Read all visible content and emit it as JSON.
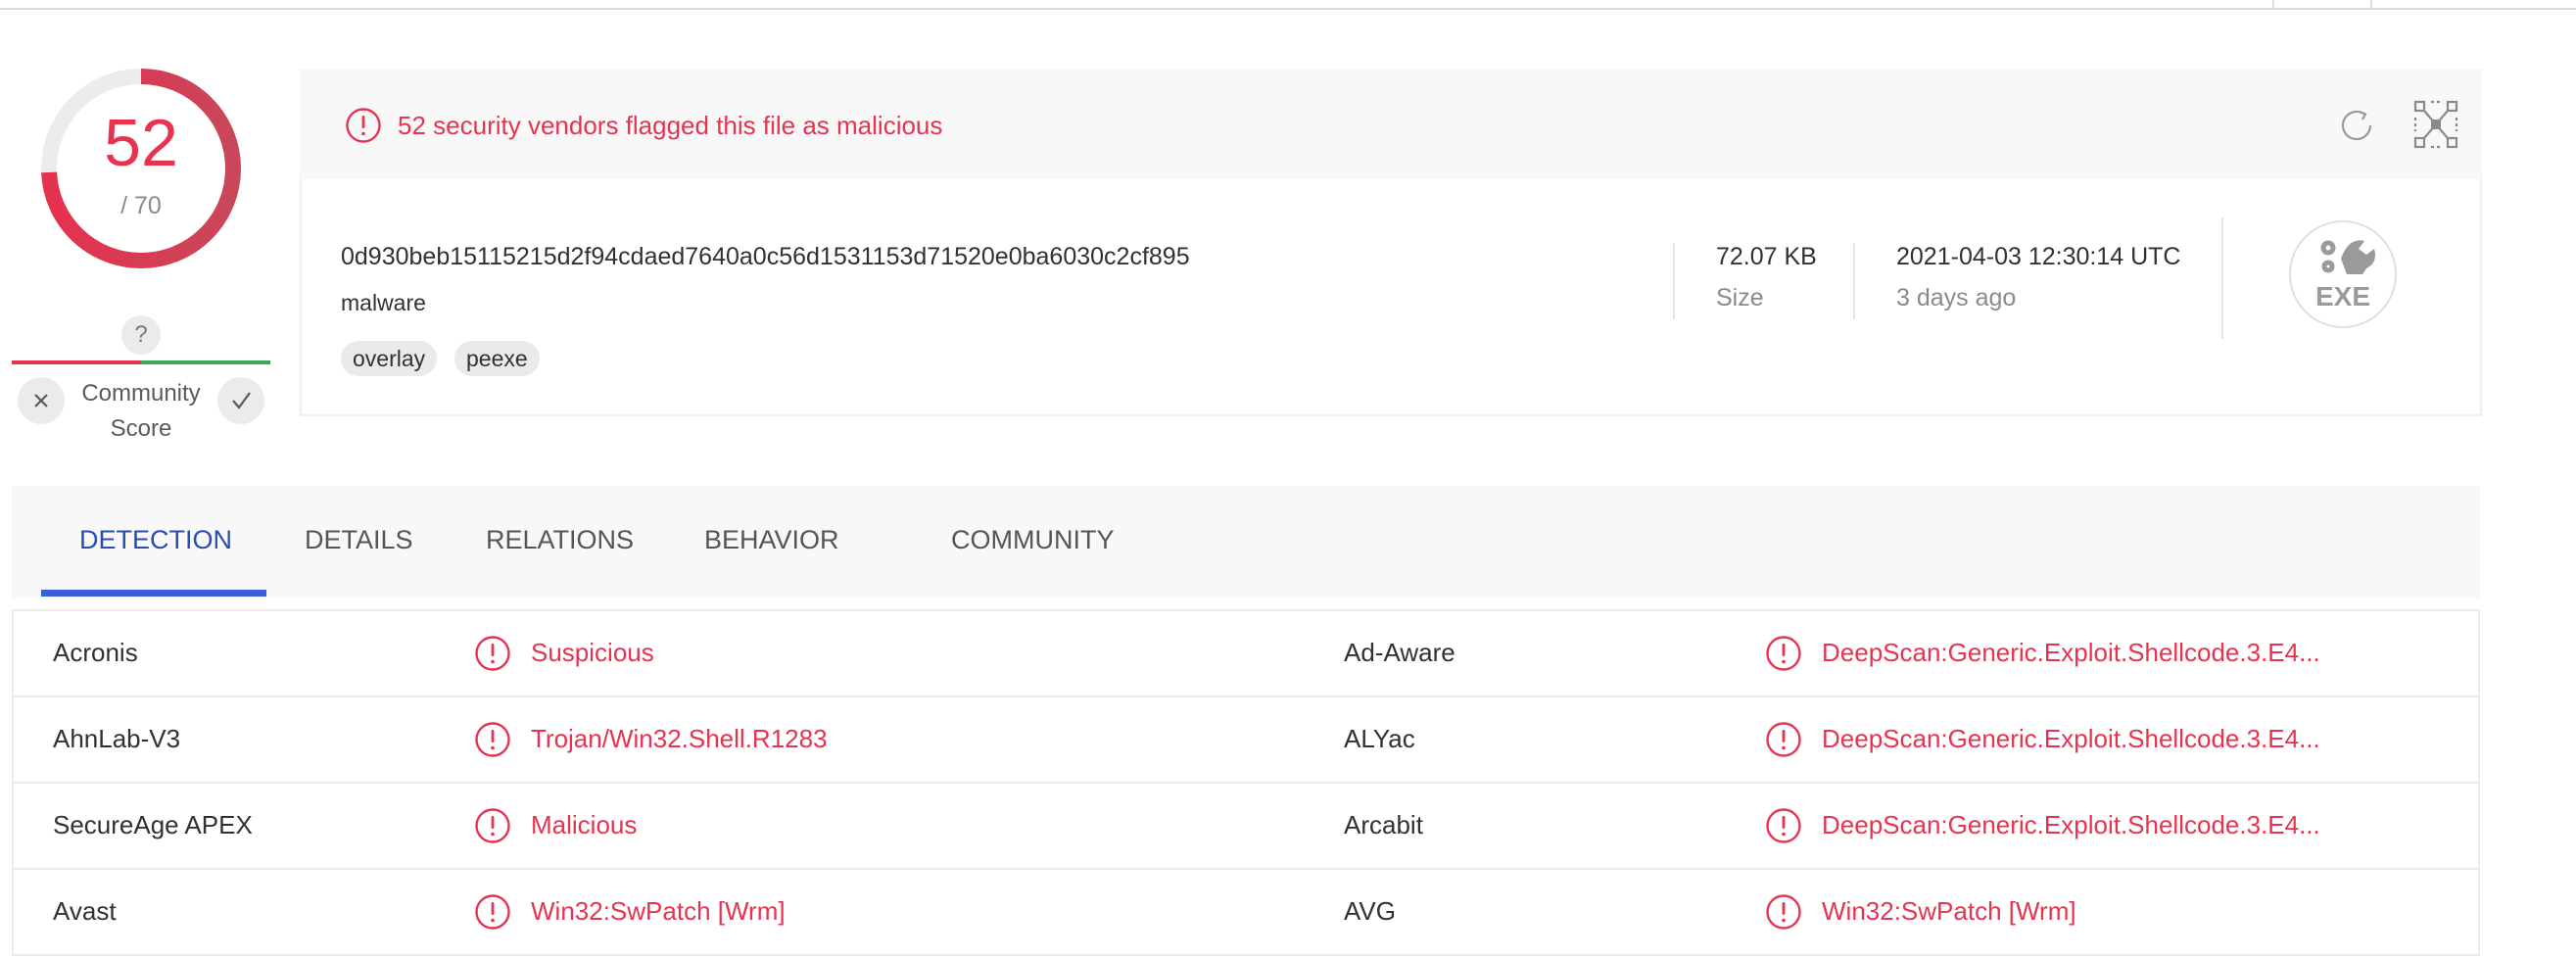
{
  "score": {
    "detections": "52",
    "total": "/ 70",
    "detection_fraction": 0.743
  },
  "community_score": {
    "question": "?",
    "label": "Community Score",
    "label_line1": "Community",
    "label_line2": "Score"
  },
  "alert": {
    "text": "52 security vendors flagged this file as malicious"
  },
  "file": {
    "hash": "0d930beb15115215d2f94cdaed7640a0c56d1531153d71520e0ba6030c2cf895",
    "name": "malware",
    "tags": [
      "overlay",
      "peexe"
    ],
    "size_value": "72.07 KB",
    "size_label": "Size",
    "date_value": "2021-04-03 12:30:14 UTC",
    "date_label": "3 days ago",
    "type_badge": "EXE"
  },
  "tabs": [
    {
      "label": "DETECTION",
      "active": true
    },
    {
      "label": "DETAILS",
      "active": false
    },
    {
      "label": "RELATIONS",
      "active": false
    },
    {
      "label": "BEHAVIOR",
      "active": false
    },
    {
      "label": "COMMUNITY",
      "active": false
    }
  ],
  "detections": [
    {
      "left_vendor": "Acronis",
      "left_result": "Suspicious",
      "right_vendor": "Ad-Aware",
      "right_result": "DeepScan:Generic.Exploit.Shellcode.3.E4..."
    },
    {
      "left_vendor": "AhnLab-V3",
      "left_result": "Trojan/Win32.Shell.R1283",
      "right_vendor": "ALYac",
      "right_result": "DeepScan:Generic.Exploit.Shellcode.3.E4..."
    },
    {
      "left_vendor": "SecureAge APEX",
      "left_result": "Malicious",
      "right_vendor": "Arcabit",
      "right_result": "DeepScan:Generic.Exploit.Shellcode.3.E4..."
    },
    {
      "left_vendor": "Avast",
      "left_result": "Win32:SwPatch [Wrm]",
      "right_vendor": "AVG",
      "right_result": "Win32:SwPatch [Wrm]"
    }
  ],
  "colors": {
    "malicious": "#e53350",
    "clean": "#39a856",
    "active_tab": "#3b5fd9"
  },
  "icons": {
    "alert": "exclamation-circle-icon",
    "refresh": "refresh-icon",
    "expand": "expand-icon",
    "dislike": "close-icon",
    "like": "check-icon",
    "result": "exclamation-circle-icon"
  }
}
